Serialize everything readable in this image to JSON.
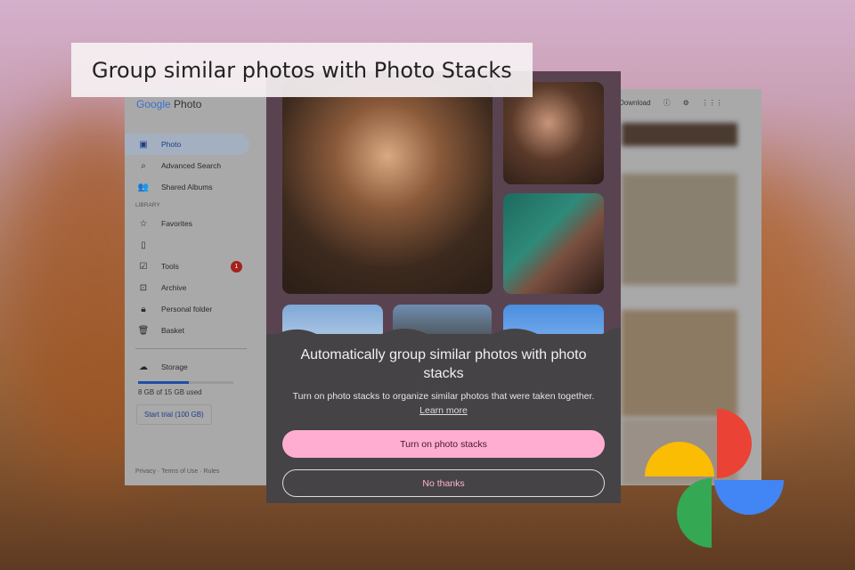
{
  "caption": "Group similar photos with Photo Stacks",
  "app": {
    "logo_google": "Google",
    "logo_photo": "Photo",
    "nav": [
      {
        "label": "Photo",
        "icon": "image-icon"
      },
      {
        "label": "Advanced Search",
        "icon": "search-icon"
      },
      {
        "label": "Shared Albums",
        "icon": "people-icon"
      }
    ],
    "library_heading": "LIBRARY",
    "library": [
      {
        "label": "Favorites"
      },
      {
        "label": ""
      },
      {
        "label": "Tools",
        "badge": "1"
      },
      {
        "label": "Archive"
      },
      {
        "label": "Personal folder"
      },
      {
        "label": "Basket"
      }
    ],
    "storage_label": "Storage",
    "storage_used": "8 GB of 15 GB used",
    "storage_fraction": 0.53,
    "trial_button": "Start trial (100 GB)",
    "footer": [
      "Privacy",
      "Terms of Use",
      "Rules"
    ],
    "download": "Download"
  },
  "dialog": {
    "title": "Automatically group similar photos with photo stacks",
    "subtitle": "Turn on photo stacks to organize similar photos that were taken together.",
    "learn_more": "Learn more",
    "primary": "Turn on photo stacks",
    "secondary": "No thanks"
  },
  "colors": {
    "primary_btn": "#ffaed2",
    "panel": "#454345",
    "badge": "#a3221b"
  }
}
